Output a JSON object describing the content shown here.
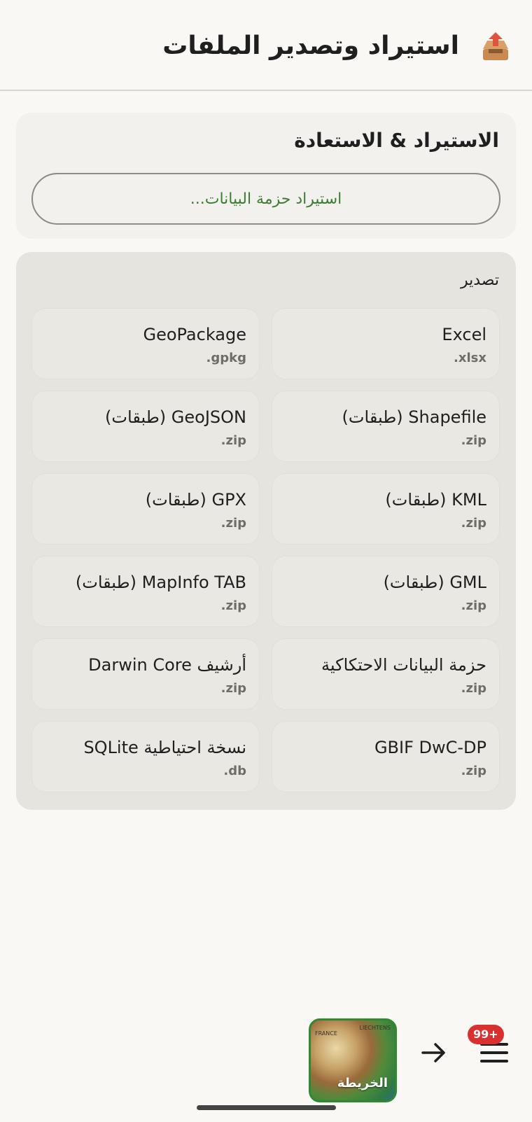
{
  "header": {
    "icon": "outbox-tray-icon",
    "title": "استيراد وتصدير الملفات"
  },
  "import_section": {
    "title": "الاستيراد & الاستعادة",
    "button_label": "استيراد حزمة البيانات..."
  },
  "export_section": {
    "label": "تصدير",
    "items": [
      {
        "name": "Excel",
        "ext": "xlsx."
      },
      {
        "name": "GeoPackage",
        "ext": "gpkg."
      },
      {
        "name": "Shapefile (طبقات)",
        "ext": "zip."
      },
      {
        "name": "GeoJSON (طبقات)",
        "ext": "zip."
      },
      {
        "name": "KML (طبقات)",
        "ext": "zip."
      },
      {
        "name": "GPX (طبقات)",
        "ext": "zip."
      },
      {
        "name": "GML (طبقات)",
        "ext": "zip."
      },
      {
        "name": "MapInfo TAB (طبقات)",
        "ext": "zip."
      },
      {
        "name": "حزمة البيانات الاحتكاكية",
        "ext": "zip."
      },
      {
        "name": "أرشيف Darwin Core",
        "ext": "zip."
      },
      {
        "name": "GBIF DwC-DP",
        "ext": "zip."
      },
      {
        "name": "نسخة احتياطية SQLite",
        "ext": "db."
      }
    ]
  },
  "bottom_bar": {
    "map_caption": "الخريطة",
    "map_label_france": "FRANCE",
    "map_label_liechtenstein": "LIECHTENS",
    "badge": "+99"
  },
  "colors": {
    "accent_green": "#3c7d34",
    "badge_red": "#d93030",
    "background": "#f9f8f5"
  }
}
